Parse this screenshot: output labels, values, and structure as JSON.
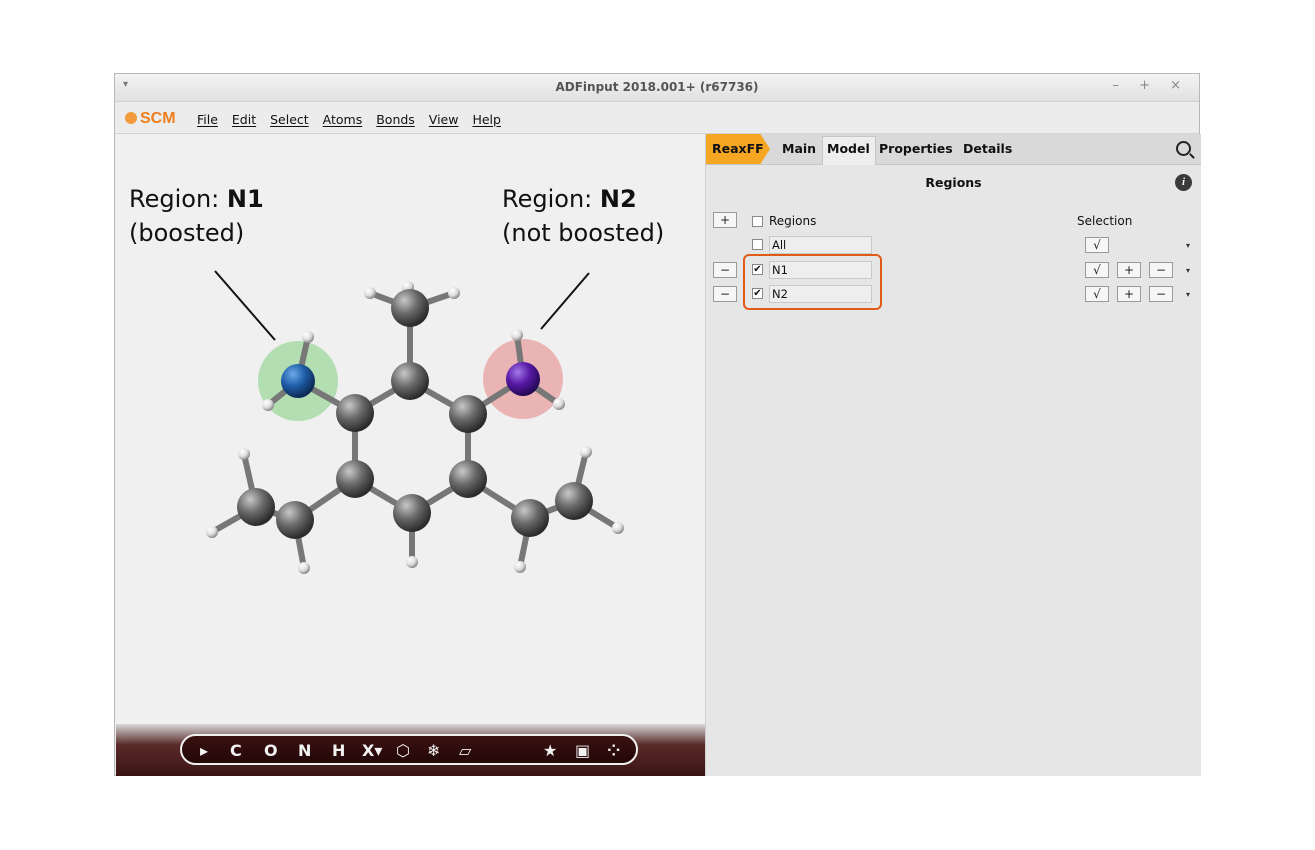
{
  "window": {
    "title": "ADFinput 2018.001+ (r67736)",
    "menu_glyph": "▾",
    "controls": "– + ×"
  },
  "menubar": {
    "logo": "SCM",
    "items": [
      "File",
      "Edit",
      "Select",
      "Atoms",
      "Bonds",
      "View",
      "Help"
    ]
  },
  "annotations": {
    "left": {
      "prefix": "Region: ",
      "name": "N1",
      "note": "(boosted)"
    },
    "right": {
      "prefix": "Region: ",
      "name": "N2",
      "note": "(not boosted)"
    }
  },
  "toolbar": {
    "items": [
      "▸",
      "C",
      "O",
      "N",
      "H",
      "X▾",
      "⬡",
      "❄",
      "▱",
      "★",
      "▣",
      "⁘"
    ]
  },
  "panel": {
    "tabs": [
      "ReaxFF",
      "Main",
      "Model",
      "Properties",
      "Details"
    ],
    "active_tab": "Model",
    "section_title": "Regions",
    "header_label": "Regions",
    "selection_label": "Selection",
    "rows": [
      {
        "name": "All",
        "checked": false
      },
      {
        "name": "N1",
        "checked": true
      },
      {
        "name": "N2",
        "checked": true
      }
    ],
    "button_glyphs": {
      "add": "+",
      "remove": "−",
      "select": "√",
      "dropdown": "▾",
      "info": "i",
      "check": "✔"
    }
  },
  "colors": {
    "accent": "#f5a623",
    "highlight": "#e05a18",
    "region_n1": "#7fcf7f",
    "region_n2": "#e88c8c",
    "nitrogen_n1": "#1f5fa8",
    "nitrogen_n2": "#5a1aa8"
  }
}
